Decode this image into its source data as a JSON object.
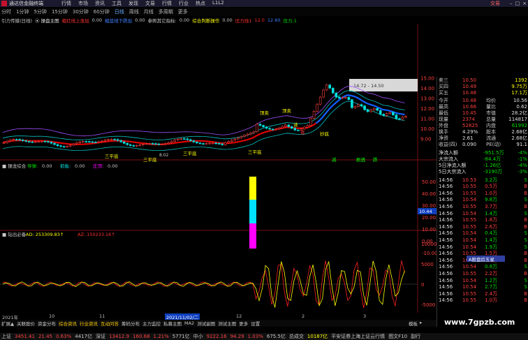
{
  "titlebar": {
    "app_title": "通达信金融终端",
    "menus": [
      "行情",
      "市场",
      "资讯",
      "工具",
      "发现",
      "文易",
      "行情",
      "行业",
      "热点",
      "L1L2"
    ],
    "trade": "交易",
    "win_buttons": [
      "–",
      "□",
      "×"
    ]
  },
  "toolbar": {
    "periods": [
      "分时",
      "1分钟",
      "5分钟",
      "15分钟",
      "30分钟",
      "60分钟",
      "日线",
      "周线",
      "月线",
      "多周期",
      "更多"
    ],
    "active_index": 6
  },
  "indicator_header": {
    "items": [
      {
        "text": "引力传媒(日线)",
        "color": "#c8c8c8"
      },
      {
        "text": "⦿ 操盘主图",
        "color": "#e0e0e0"
      },
      {
        "text": "粗红线上涨加",
        "color": "#ff3030"
      },
      {
        "text": "0.00",
        "color": "#c8c8c8"
      },
      {
        "text": "粗蓝线下跌加",
        "color": "#4080ff"
      },
      {
        "text": "0.00",
        "color": "#c8c8c8"
      },
      {
        "text": "参照其它指标:",
        "color": "#c8c8c8"
      },
      {
        "text": "0.00",
        "color": "#c8c8c8"
      },
      {
        "text": "综合判断操作",
        "color": "#ffff00"
      },
      {
        "text": "0.00",
        "color": "#c8c8c8"
      },
      {
        "text": "压力线1",
        "color": "#ff3030"
      },
      {
        "text": "12.0",
        "color": "#ff3030"
      },
      {
        "text": "12.60",
        "color": "#4080ff"
      },
      {
        "text": "压力:1",
        "color": "#00e000"
      }
    ]
  },
  "main_chart": {
    "price_labels": [
      "15.00",
      "14.00",
      "13.00",
      "12.00",
      "11.00",
      "10.00",
      "9.00"
    ],
    "annotations": [
      {
        "text": "三平底",
        "color": "#ffff00"
      },
      {
        "text": "三平底",
        "color": "#ffff00"
      },
      {
        "text": "三平底",
        "color": "#ffff00"
      },
      {
        "text": "顶卖",
        "color": "#ffff00"
      },
      {
        "text": "顶卖",
        "color": "#ffff00"
      },
      {
        "text": "抄底",
        "color": "#ffff00"
      },
      {
        "text": "诱",
        "color": "#ffff00"
      },
      {
        "text": "逃",
        "color": "#ff3030"
      },
      {
        "text": "剧透",
        "color": "#00ff00"
      },
      {
        "text": "跌",
        "color": "#00ff00"
      },
      {
        "text": "减",
        "color": "#00ff00"
      },
      {
        "text": "三平底",
        "color": "#ffff00"
      }
    ],
    "range_box": "14.72 - 14.50",
    "low_label": "8.02"
  },
  "sub1": {
    "header": [
      {
        "text": "■ 操龙综合",
        "color": "#c8c8c8"
      },
      {
        "text": "导弹:",
        "color": "#00e000"
      },
      {
        "text": "0.00",
        "color": "#c8c8c8"
      },
      {
        "text": "抓板:",
        "color": "#00e0e0"
      },
      {
        "text": "0.00",
        "color": "#c8c8c8"
      },
      {
        "text": "庄顶:",
        "color": "#ff00ff"
      },
      {
        "text": "0.00",
        "color": "#c8c8c8"
      }
    ],
    "axis": [
      "50.00",
      "40.00",
      "30.00",
      "20.00",
      "10.00",
      "0.00",
      "-10.00"
    ],
    "cursor_value": "10.44"
  },
  "sub2": {
    "header": [
      {
        "text": "■ 钻出必备",
        "color": "#c8c8c8"
      },
      {
        "text": "AD: 253309.83↑",
        "color": "#ffff00"
      },
      {
        "text": "AZ: 150233.16↑",
        "color": "#ff3030"
      }
    ],
    "axis": [
      "10000",
      "5000",
      "0",
      "-5000",
      "-10000"
    ]
  },
  "date_bar": {
    "labels": [
      "2021年",
      "10",
      "11",
      "12",
      "2",
      "3"
    ],
    "highlight": "2021/11/02/二"
  },
  "tabs": [
    "扩展▲",
    "关联股价",
    "资金分布",
    "综合资讯",
    "行业资讯",
    "互动问答",
    "筹码分布",
    "主力监控",
    "私募主图",
    "MA2",
    "测试副图",
    "测试主图",
    "更多",
    "设置"
  ],
  "right_tabs": [
    "模板",
    "▸"
  ],
  "right_panel": {
    "asks": [
      {
        "label": "卖三",
        "price": "10.50",
        "vol": "1392"
      },
      {
        "label": "买四",
        "price": "10.49",
        "vol": "9.75万"
      },
      {
        "label": "买五",
        "price": "10.48",
        "vol": "17.1万"
      }
    ],
    "quote": [
      {
        "k1": "今开",
        "v1": "10.48",
        "k2": "均价",
        "v2": "10.56"
      },
      {
        "k1": "最高",
        "v1": "10.66",
        "k2": "量比",
        "v2": "0.62"
      },
      {
        "k1": "最低",
        "v1": "10.45",
        "k2": "市值",
        "v2": "28.2亿"
      },
      {
        "k1": "现量",
        "v1": "2374",
        "k2": "总量",
        "v2": "114817"
      },
      {
        "k1": "外盘",
        "v1": "52825",
        "k2": "内盘",
        "v2": "61992"
      },
      {
        "k1": "换手",
        "v1": "4.29%",
        "k2": "股本",
        "v2": "2.68亿"
      },
      {
        "k1": "净资",
        "v1": "2.61",
        "k2": "流通",
        "v2": "2.68亿"
      },
      {
        "k1": "收益(四)",
        "v1": "0.090",
        "k2": "PE(动)",
        "v2": "91.1"
      }
    ],
    "flows": [
      {
        "label": "净流入额",
        "value": "-951.5万",
        "pct": "-4%"
      },
      {
        "label": "大宗流入",
        "value": "-84.4万",
        "pct": "-1%"
      },
      {
        "label": "5日净流入额",
        "value": "-1.26亿",
        "pct": "-4%"
      },
      {
        "label": "5日大宗流入",
        "value": "-3190万",
        "pct": "-3%"
      }
    ],
    "ticks": [
      {
        "time": "14:56",
        "price": "10.53",
        "vol": "3.2万",
        "dir": "S"
      },
      {
        "time": "14:56",
        "price": "10.55",
        "vol": "0.5万",
        "dir": "B"
      },
      {
        "time": "14:56",
        "price": "10.55",
        "vol": "1.0万",
        "dir": "B"
      },
      {
        "time": "14:56",
        "price": "10.54",
        "vol": "9.8万",
        "dir": "S"
      },
      {
        "time": "14:56",
        "price": "10.55",
        "vol": "3.7万",
        "dir": "B"
      },
      {
        "time": "14:56",
        "price": "10.54",
        "vol": "1.4万",
        "dir": "S"
      },
      {
        "time": "14:56",
        "price": "10.55",
        "vol": "1.8万",
        "dir": "B"
      },
      {
        "time": "14:56",
        "price": "10.55",
        "vol": "2.6万",
        "dir": "B"
      },
      {
        "time": "14:56",
        "price": "10.54",
        "vol": "0.4万",
        "dir": "S"
      },
      {
        "time": "14:56",
        "price": "10.54",
        "vol": "1.4万",
        "dir": "S"
      },
      {
        "time": "14:56",
        "price": "10.54",
        "vol": "1.9万",
        "dir": "S"
      },
      {
        "time": "14:56",
        "price": "10.55",
        "vol": "1.5万",
        "dir": "B"
      },
      {
        "time": "14:56",
        "price": "10.55",
        "vol": "1.1万",
        "dir": "B"
      },
      {
        "time": "14:56",
        "price": "10.54",
        "vol": "0.8万",
        "dir": "S"
      },
      {
        "time": "14:56",
        "price": "10.55",
        "vol": "2.2万",
        "dir": "B"
      },
      {
        "time": "14:56",
        "price": "10.54",
        "vol": "1.2万",
        "dir": "S"
      },
      {
        "time": "14:56",
        "price": "10.54",
        "vol": "2.7万",
        "dir": "S"
      },
      {
        "time": "14:56",
        "price": "10.55",
        "vol": "2.4万",
        "dir": "B"
      },
      {
        "time": "14:56",
        "price": "10.55",
        "vol": "1.0万",
        "dir": "B"
      }
    ],
    "popup": "A股盘后五星"
  },
  "statusbar": {
    "items": [
      {
        "text": "上证",
        "color": "#c8c8c8"
      },
      {
        "text": "3451.41",
        "color": "#ff4040"
      },
      {
        "text": "21.45",
        "color": "#ff4040"
      },
      {
        "text": "0.63%",
        "color": "#ff4040"
      },
      {
        "text": "4417亿",
        "color": "#c8c8c8"
      },
      {
        "text": "深证",
        "color": "#c8c8c8"
      },
      {
        "text": "13412.9",
        "color": "#ff4040"
      },
      {
        "text": "160.68",
        "color": "#ff4040"
      },
      {
        "text": "1.21%",
        "color": "#ff4040"
      },
      {
        "text": "5771亿",
        "color": "#c8c8c8"
      },
      {
        "text": "中小",
        "color": "#c8c8c8"
      },
      {
        "text": "9222.16",
        "color": "#ff4040"
      },
      {
        "text": "94.29",
        "color": "#ff4040"
      },
      {
        "text": "1.03%",
        "color": "#ff4040"
      },
      {
        "text": "675.5亿",
        "color": "#c8c8c8"
      },
      {
        "text": "总成交",
        "color": "#c8c8c8"
      },
      {
        "text": "10187亿",
        "color": "#ffff00"
      },
      {
        "text": "平安证券上海上证云行情",
        "color": "#c8c8c8"
      },
      {
        "text": "图文F10",
        "color": "#c8c8c8"
      },
      {
        "text": "副行",
        "color": "#c8c8c8"
      }
    ]
  },
  "watermark": "www.7gpzb.com",
  "colors": {
    "up": "#ff4040",
    "down": "#00e000",
    "ma_red": "#e00000",
    "ma_blue": "#1060ff",
    "band": "#00c0c0",
    "purple": "#a050ff"
  }
}
